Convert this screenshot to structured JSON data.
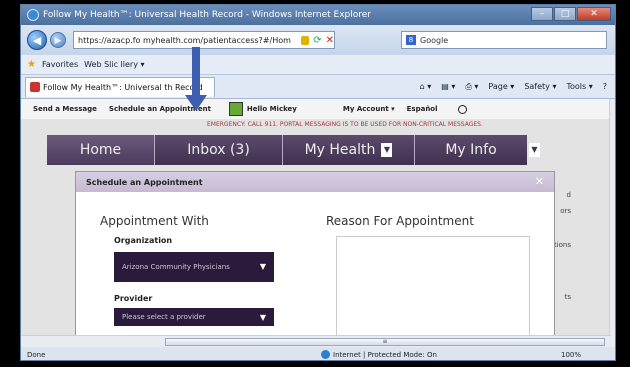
{
  "window": {
    "title": "Follow My Health™: Universal Health Record - Windows Internet Explorer",
    "controls": {
      "minimize": "–",
      "maximize": "□",
      "close": "✕"
    }
  },
  "address_bar": {
    "url": "https://azacp.fo   myhealth.com/patientaccess?#/Hom",
    "search_placeholder": "Google"
  },
  "favorites_bar": {
    "favorites_label": "Favorites",
    "web_slice_label": "Web Slic  llery ▾"
  },
  "tab": {
    "title": "Follow My Health™: Universal  th Record"
  },
  "command_bar": {
    "page": "Page ▾",
    "safety": "Safety ▾",
    "tools": "Tools ▾",
    "help": "?"
  },
  "site": {
    "utility_links": {
      "send_message": "Send a Message",
      "schedule": "Schedule an Appointment",
      "greeting": "Hello Mickey",
      "account": "My Account ▾",
      "language": "Español"
    },
    "emergency_text": "EMERGENCY: CALL 911. PORTAL MESSAGING IS TO BE USED FOR NON-CRITICAL MESSAGES.",
    "nav": {
      "home": "Home",
      "inbox": "Inbox (3)",
      "health": "My Health",
      "info": "My Info"
    },
    "side_fragments": [
      "d",
      "ors",
      "tions",
      "ts"
    ]
  },
  "modal": {
    "title": "Schedule an Appointment",
    "close": "✕",
    "appointment_with": "Appointment With",
    "reason_for": "Reason For Appointment",
    "organization_label": "Organization",
    "organization_value": "Arizona Community Physicians",
    "provider_label": "Provider",
    "provider_placeholder": "Please select a provider"
  },
  "scrollbar": {
    "thumb_grip": "≡"
  },
  "status_bar": {
    "done": "Done",
    "zone": "Internet | Protected Mode: On",
    "zoom": "100%"
  },
  "colors": {
    "nav_purple": "#3f3150",
    "annotation_arrow": "#3e5fb0",
    "select_bg": "#2a1a3c"
  }
}
